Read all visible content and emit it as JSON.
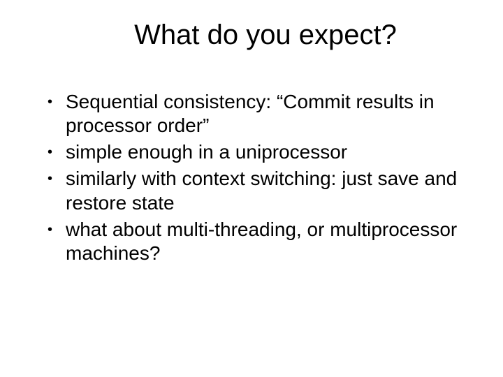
{
  "title": "What do you expect?",
  "bullets": [
    "Sequential consistency: “Commit results in processor order”",
    "simple enough in a uniprocessor",
    "similarly with context switching: just save and restore state",
    "what about multi-threading, or multiprocessor machines?"
  ]
}
